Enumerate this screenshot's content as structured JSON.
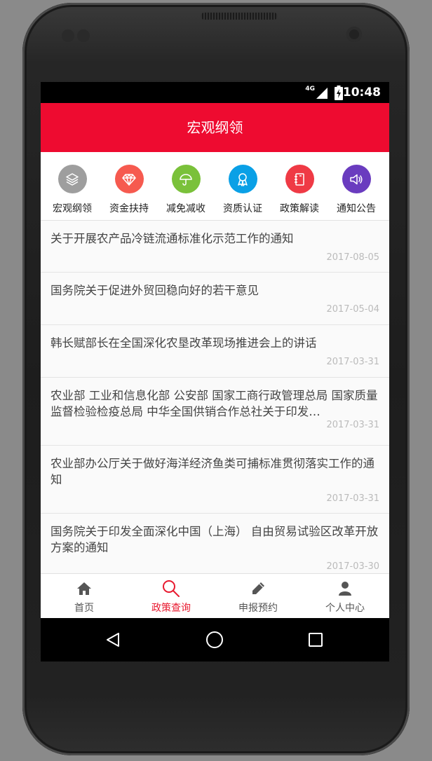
{
  "status_bar": {
    "network": "4G",
    "time": "10:48"
  },
  "app_bar": {
    "title": "宏观纲领"
  },
  "categories": [
    {
      "label": "宏观纲领",
      "icon": "layers-icon",
      "color": "#9e9e9e"
    },
    {
      "label": "资金扶持",
      "icon": "diamond-icon",
      "color": "#f65a4f"
    },
    {
      "label": "减免减收",
      "icon": "umbrella-icon",
      "color": "#7ac13a"
    },
    {
      "label": "资质认证",
      "icon": "award-icon",
      "color": "#0aa0e6"
    },
    {
      "label": "政策解读",
      "icon": "notebook-icon",
      "color": "#ef3a45"
    },
    {
      "label": "通知公告",
      "icon": "speaker-icon",
      "color": "#6a3cbf"
    }
  ],
  "news": [
    {
      "title": "关于开展农产品冷链流通标准化示范工作的通知",
      "date": "2017-08-05"
    },
    {
      "title": "国务院关于促进外贸回稳向好的若干意见",
      "date": "2017-05-04"
    },
    {
      "title": "韩长赋部长在全国深化农垦改革现场推进会上的讲话",
      "date": "2017-03-31"
    },
    {
      "title": "农业部 工业和信息化部 公安部 国家工商行政管理总局 国家质量监督检验检疫总局 中华全国供销合作总社关于印发…",
      "date": "2017-03-31"
    },
    {
      "title": "农业部办公厅关于做好海洋经济鱼类可捕标准贯彻落实工作的通知",
      "date": "2017-03-31"
    },
    {
      "title": "国务院关于印发全面深化中国（上海） 自由贸易试验区改革开放方案的通知",
      "date": "2017-03-30"
    }
  ],
  "tabs": [
    {
      "label": "首页",
      "icon": "home-icon",
      "active": false
    },
    {
      "label": "政策查询",
      "icon": "search-icon",
      "active": true
    },
    {
      "label": "申报预约",
      "icon": "pencil-icon",
      "active": false
    },
    {
      "label": "个人中心",
      "icon": "user-icon",
      "active": false
    }
  ],
  "colors": {
    "accent": "#ee0b30",
    "active_tab": "#e8192f"
  }
}
